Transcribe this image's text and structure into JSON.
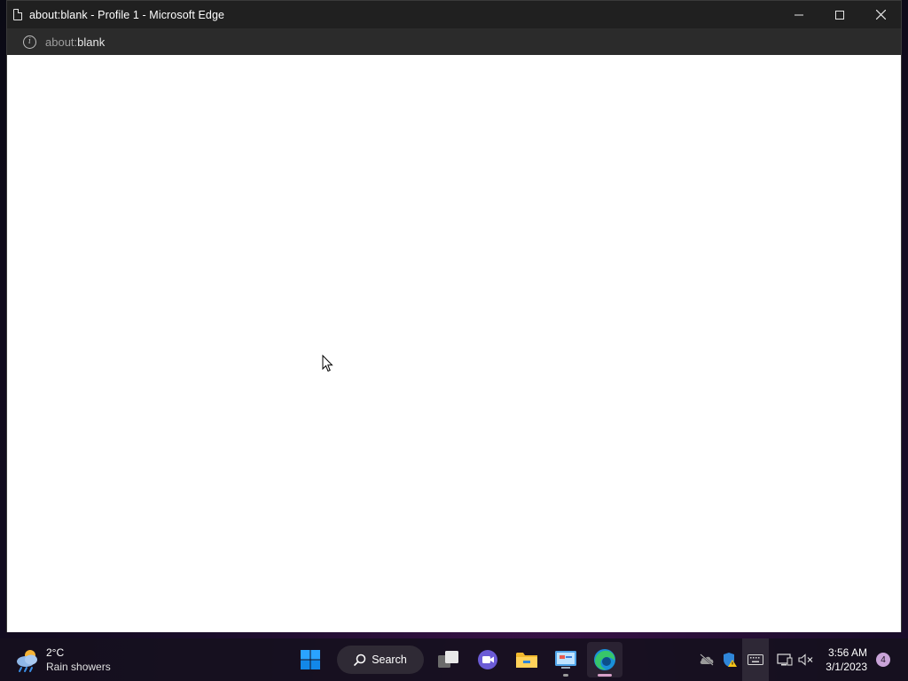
{
  "window": {
    "title": "about:blank - Profile 1 - Microsoft Edge",
    "page_icon": "blank-page-icon",
    "controls": [
      "minimize-icon",
      "maximize-icon",
      "close-icon"
    ]
  },
  "address_bar": {
    "info_icon": "info-icon",
    "url_scheme": "about:",
    "url_rest": "blank"
  },
  "taskbar": {
    "weather": {
      "temperature": "2°C",
      "condition": "Rain showers",
      "icon": "rain-cloud-icon"
    },
    "search_label": "Search",
    "pinned": [
      {
        "name": "start",
        "icon": "windows-start-icon"
      },
      {
        "name": "task-view",
        "icon": "task-view-icon"
      },
      {
        "name": "teams-chat",
        "icon": "video-chat-icon"
      },
      {
        "name": "file-explorer",
        "icon": "folder-icon"
      },
      {
        "name": "control-panel",
        "icon": "control-panel-icon"
      },
      {
        "name": "edge",
        "icon": "edge-icon"
      }
    ],
    "tray": {
      "icons": [
        "cloud-offline-icon",
        "defender-warning-icon",
        "keyboard-icon",
        "network-icon",
        "volume-muted-icon"
      ],
      "time": "3:56 AM",
      "date": "3/1/2023",
      "notification_count": "4"
    }
  },
  "colors": {
    "titlebar": "#202020",
    "addressbar": "#2b2b2b",
    "page_background": "#ffffff",
    "accent_blue": "#0078d4"
  }
}
